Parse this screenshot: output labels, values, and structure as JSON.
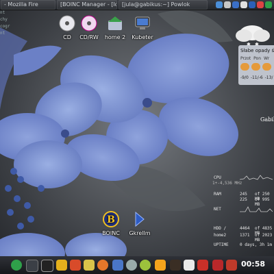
{
  "taskbar": {
    "tasks": [
      "- Mozilla Fire",
      "[BOINC Manager - [localh",
      "[jula@gabikus:~] Powlok"
    ]
  },
  "left_strip": [
    "nt",
    "chy",
    "cogr",
    "nt"
  ],
  "desktop_icons": [
    {
      "label": "CD",
      "icon": "cd-icon"
    },
    {
      "label": "CD/RW",
      "icon": "cdrw-icon"
    },
    {
      "label": "home 2",
      "icon": "home-folder-icon"
    },
    {
      "label": "Kubeter",
      "icon": "computer-icon"
    },
    {
      "label": "BOINC",
      "icon": "boinc-icon"
    },
    {
      "label": "Gkrellm",
      "icon": "gkrellm-icon"
    }
  ],
  "weather": {
    "description": "Słabe opady ś",
    "days": [
      "Przot",
      "Pon",
      "Wr"
    ],
    "temps": [
      "-9/0",
      "-11/-6",
      "-13/"
    ]
  },
  "sysmon": {
    "host": "Gabik",
    "rows": [
      {
        "label": "CPU",
        "value": "",
        "max": ""
      },
      {
        "label": "RAM",
        "value": "245",
        "max": "of 250 MB"
      },
      {
        "label": "",
        "value": "225",
        "max": "of 995 MB"
      },
      {
        "label": "NET",
        "value": "",
        "max": ""
      },
      {
        "label": "HDD /",
        "value": "4464",
        "max": "of 4835 MB"
      },
      {
        "label": "home2",
        "value": "1371",
        "max": "of 2023 MB"
      },
      {
        "label": "UPTIME",
        "value": "0 days, 3h 1m",
        "max": ""
      }
    ],
    "cpu_freq": "1+-4,536 MHz"
  },
  "clock": "00:58"
}
